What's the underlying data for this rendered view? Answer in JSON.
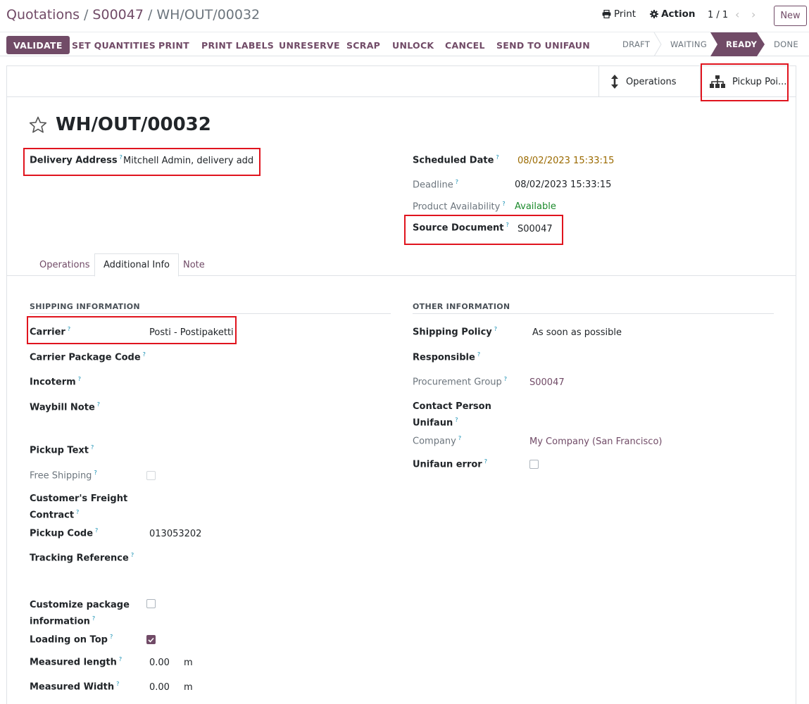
{
  "breadcrumb": {
    "root": "Quotations",
    "parent": "S00047",
    "current": "WH/OUT/00032"
  },
  "top_actions": {
    "print": "Print",
    "action": "Action",
    "pager": "1 / 1",
    "new": "New"
  },
  "action_bar": {
    "validate": "VALIDATE",
    "buttons": [
      "SET QUANTITIES",
      "PRINT",
      "PRINT LABELS",
      "UNRESERVE",
      "SCRAP",
      "UNLOCK",
      "CANCEL",
      "SEND TO UNIFAUN"
    ]
  },
  "status_bar": {
    "stages": [
      "DRAFT",
      "WAITING",
      "READY",
      "DONE"
    ],
    "active": "READY"
  },
  "smart_buttons": {
    "operations": "Operations",
    "pickup": "Pickup Poi..."
  },
  "record": {
    "title": "WH/OUT/00032",
    "delivery_address_label": "Delivery Address",
    "delivery_address": "Mitchell Admin, delivery add",
    "scheduled_date_label": "Scheduled Date",
    "scheduled_date": "08/02/2023 15:33:15",
    "deadline_label": "Deadline",
    "deadline": "08/02/2023 15:33:15",
    "availability_label": "Product Availability",
    "availability": "Available",
    "source_document_label": "Source Document",
    "source_document": "S00047"
  },
  "tabs": [
    "Operations",
    "Additional Info",
    "Note"
  ],
  "shipping": {
    "heading": "SHIPPING INFORMATION",
    "carrier_label": "Carrier",
    "carrier": "Posti - Postipaketti",
    "carrier_package_code_label": "Carrier Package Code",
    "incoterm_label": "Incoterm",
    "waybill_note_label": "Waybill Note",
    "pickup_text_label": "Pickup Text",
    "free_shipping_label": "Free Shipping",
    "freight_contract_label_1": "Customer's Freight",
    "freight_contract_label_2": "Contract",
    "pickup_code_label": "Pickup Code",
    "pickup_code": "013053202",
    "tracking_reference_label": "Tracking Reference",
    "customize_label_1": "Customize package",
    "customize_label_2": "information",
    "loading_on_top_label": "Loading on Top",
    "loading_on_top": true,
    "measured_length_label": "Measured length",
    "measured_length": "0.00",
    "measured_width_label": "Measured Width",
    "measured_width": "0.00",
    "unit": "m"
  },
  "other": {
    "heading": "OTHER INFORMATION",
    "shipping_policy_label": "Shipping Policy",
    "shipping_policy": "As soon as possible",
    "responsible_label": "Responsible",
    "procurement_group_label": "Procurement Group",
    "procurement_group": "S00047",
    "contact_person_label_1": "Contact Person",
    "contact_person_label_2": "Unifaun",
    "company_label": "Company",
    "company": "My Company (San Francisco)",
    "unifaun_error_label": "Unifaun error"
  },
  "help_mark": "?",
  "colors": {
    "brand": "#714b67",
    "highlight": "#e0141e",
    "available": "#1b8a2b",
    "date_warning": "#9b6a00"
  }
}
